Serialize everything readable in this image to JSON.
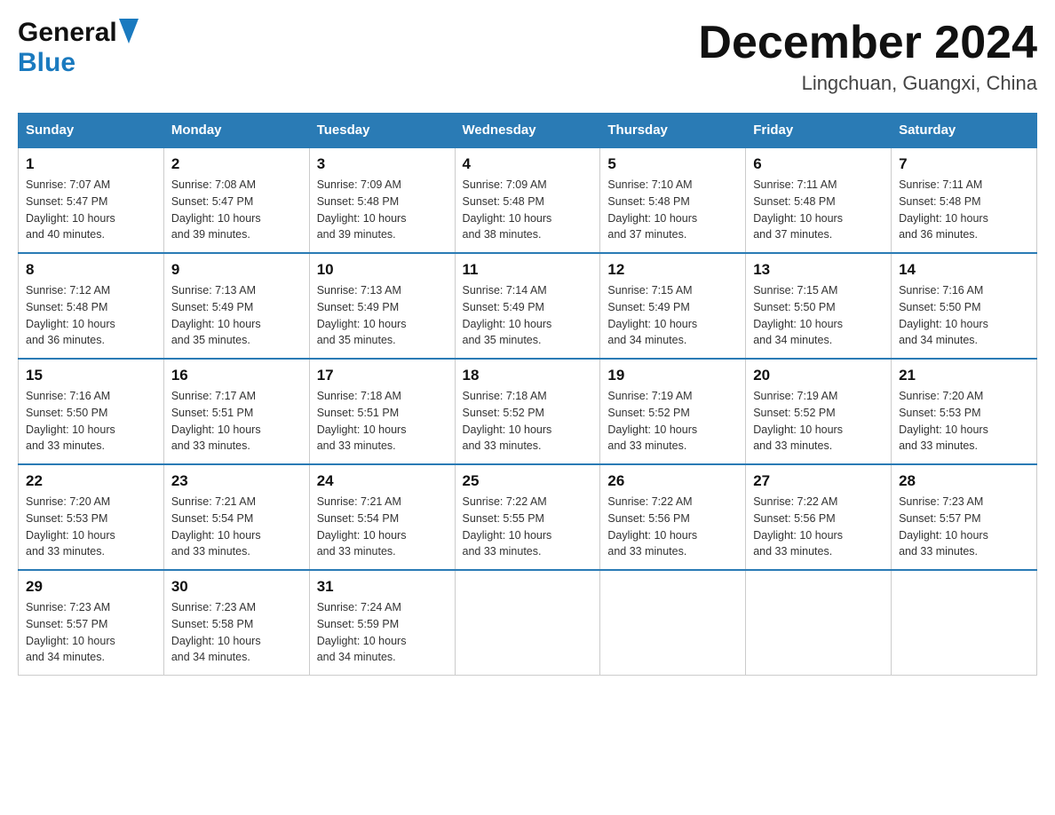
{
  "header": {
    "logo_general": "General",
    "logo_blue": "Blue",
    "month_title": "December 2024",
    "location": "Lingchuan, Guangxi, China"
  },
  "days_of_week": [
    "Sunday",
    "Monday",
    "Tuesday",
    "Wednesday",
    "Thursday",
    "Friday",
    "Saturday"
  ],
  "weeks": [
    [
      {
        "day": "1",
        "sunrise": "7:07 AM",
        "sunset": "5:47 PM",
        "daylight": "10 hours and 40 minutes."
      },
      {
        "day": "2",
        "sunrise": "7:08 AM",
        "sunset": "5:47 PM",
        "daylight": "10 hours and 39 minutes."
      },
      {
        "day": "3",
        "sunrise": "7:09 AM",
        "sunset": "5:48 PM",
        "daylight": "10 hours and 39 minutes."
      },
      {
        "day": "4",
        "sunrise": "7:09 AM",
        "sunset": "5:48 PM",
        "daylight": "10 hours and 38 minutes."
      },
      {
        "day": "5",
        "sunrise": "7:10 AM",
        "sunset": "5:48 PM",
        "daylight": "10 hours and 37 minutes."
      },
      {
        "day": "6",
        "sunrise": "7:11 AM",
        "sunset": "5:48 PM",
        "daylight": "10 hours and 37 minutes."
      },
      {
        "day": "7",
        "sunrise": "7:11 AM",
        "sunset": "5:48 PM",
        "daylight": "10 hours and 36 minutes."
      }
    ],
    [
      {
        "day": "8",
        "sunrise": "7:12 AM",
        "sunset": "5:48 PM",
        "daylight": "10 hours and 36 minutes."
      },
      {
        "day": "9",
        "sunrise": "7:13 AM",
        "sunset": "5:49 PM",
        "daylight": "10 hours and 35 minutes."
      },
      {
        "day": "10",
        "sunrise": "7:13 AM",
        "sunset": "5:49 PM",
        "daylight": "10 hours and 35 minutes."
      },
      {
        "day": "11",
        "sunrise": "7:14 AM",
        "sunset": "5:49 PM",
        "daylight": "10 hours and 35 minutes."
      },
      {
        "day": "12",
        "sunrise": "7:15 AM",
        "sunset": "5:49 PM",
        "daylight": "10 hours and 34 minutes."
      },
      {
        "day": "13",
        "sunrise": "7:15 AM",
        "sunset": "5:50 PM",
        "daylight": "10 hours and 34 minutes."
      },
      {
        "day": "14",
        "sunrise": "7:16 AM",
        "sunset": "5:50 PM",
        "daylight": "10 hours and 34 minutes."
      }
    ],
    [
      {
        "day": "15",
        "sunrise": "7:16 AM",
        "sunset": "5:50 PM",
        "daylight": "10 hours and 33 minutes."
      },
      {
        "day": "16",
        "sunrise": "7:17 AM",
        "sunset": "5:51 PM",
        "daylight": "10 hours and 33 minutes."
      },
      {
        "day": "17",
        "sunrise": "7:18 AM",
        "sunset": "5:51 PM",
        "daylight": "10 hours and 33 minutes."
      },
      {
        "day": "18",
        "sunrise": "7:18 AM",
        "sunset": "5:52 PM",
        "daylight": "10 hours and 33 minutes."
      },
      {
        "day": "19",
        "sunrise": "7:19 AM",
        "sunset": "5:52 PM",
        "daylight": "10 hours and 33 minutes."
      },
      {
        "day": "20",
        "sunrise": "7:19 AM",
        "sunset": "5:52 PM",
        "daylight": "10 hours and 33 minutes."
      },
      {
        "day": "21",
        "sunrise": "7:20 AM",
        "sunset": "5:53 PM",
        "daylight": "10 hours and 33 minutes."
      }
    ],
    [
      {
        "day": "22",
        "sunrise": "7:20 AM",
        "sunset": "5:53 PM",
        "daylight": "10 hours and 33 minutes."
      },
      {
        "day": "23",
        "sunrise": "7:21 AM",
        "sunset": "5:54 PM",
        "daylight": "10 hours and 33 minutes."
      },
      {
        "day": "24",
        "sunrise": "7:21 AM",
        "sunset": "5:54 PM",
        "daylight": "10 hours and 33 minutes."
      },
      {
        "day": "25",
        "sunrise": "7:22 AM",
        "sunset": "5:55 PM",
        "daylight": "10 hours and 33 minutes."
      },
      {
        "day": "26",
        "sunrise": "7:22 AM",
        "sunset": "5:56 PM",
        "daylight": "10 hours and 33 minutes."
      },
      {
        "day": "27",
        "sunrise": "7:22 AM",
        "sunset": "5:56 PM",
        "daylight": "10 hours and 33 minutes."
      },
      {
        "day": "28",
        "sunrise": "7:23 AM",
        "sunset": "5:57 PM",
        "daylight": "10 hours and 33 minutes."
      }
    ],
    [
      {
        "day": "29",
        "sunrise": "7:23 AM",
        "sunset": "5:57 PM",
        "daylight": "10 hours and 34 minutes."
      },
      {
        "day": "30",
        "sunrise": "7:23 AM",
        "sunset": "5:58 PM",
        "daylight": "10 hours and 34 minutes."
      },
      {
        "day": "31",
        "sunrise": "7:24 AM",
        "sunset": "5:59 PM",
        "daylight": "10 hours and 34 minutes."
      },
      null,
      null,
      null,
      null
    ]
  ],
  "labels": {
    "sunrise": "Sunrise:",
    "sunset": "Sunset:",
    "daylight": "Daylight:"
  }
}
